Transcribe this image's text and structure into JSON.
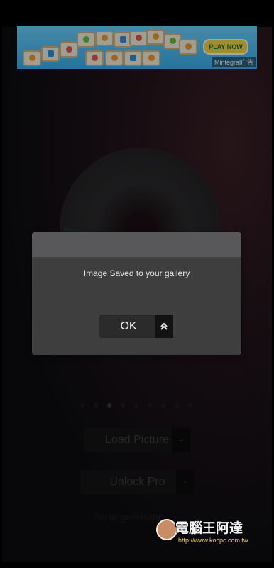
{
  "ad": {
    "cta": "PLAY NOW",
    "source": "Mintegral广告"
  },
  "background": {
    "load_picture": "Load Picture",
    "unlock_pro": "Unlock Pro",
    "hashtag": "#orangelenapp",
    "chevron": "≈"
  },
  "dialog": {
    "message": "Image Saved to your gallery",
    "ok_label": "OK",
    "ok_icon": "double-chevron-up-icon"
  },
  "watermark": {
    "title": "電腦王阿達",
    "url": "http://www.kocpc.com.tw"
  }
}
